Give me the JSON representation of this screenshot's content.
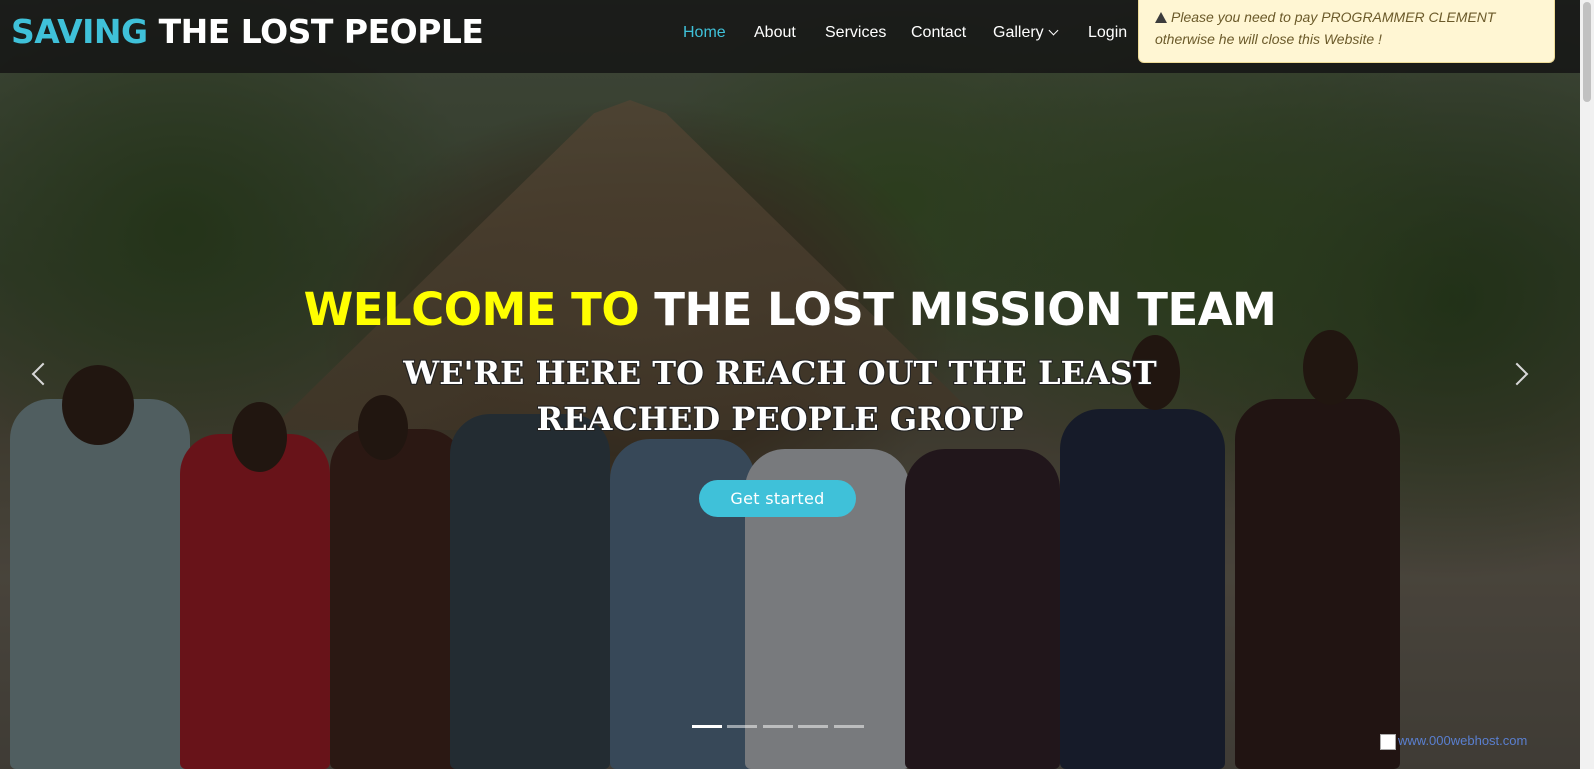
{
  "header": {
    "logo_accent": "SAVING",
    "logo_main": "THE LOST PEOPLE",
    "nav": [
      {
        "label": "Home",
        "active": true
      },
      {
        "label": "About"
      },
      {
        "label": "Services"
      },
      {
        "label": "Contact"
      },
      {
        "label": "Gallery"
      },
      {
        "label": "Login"
      }
    ]
  },
  "warning": {
    "icon": "warning-triangle-icon",
    "text": "Please you need to pay PROGRAMMER CLEMENT otherwise he will close this Website !"
  },
  "hero": {
    "welcome_yellow": "WELCOME TO",
    "welcome_white": "THE LOST MISSION TEAM",
    "tagline": "WE'RE HERE TO REACH OUT THE LEAST REACHED PEOPLE GROUP",
    "cta_label": "Get started",
    "slide_count": 5,
    "active_slide": 1
  },
  "badge": {
    "text": "www.000webhost.com"
  },
  "colors": {
    "accent": "#3fc1d9",
    "welcome_yellow": "#ffff00",
    "warning_bg": "#fff6d3"
  }
}
